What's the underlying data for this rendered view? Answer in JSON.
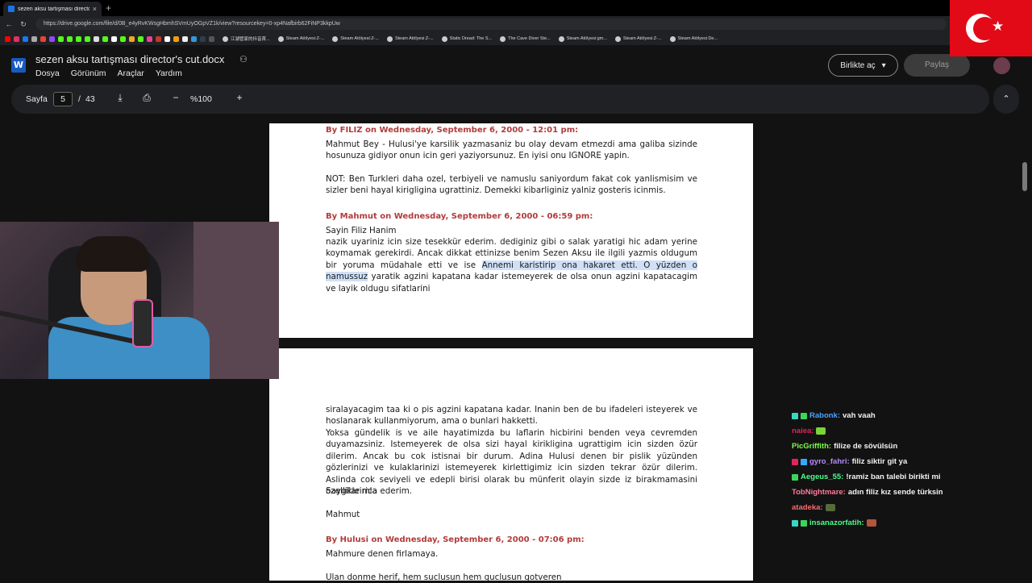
{
  "browser": {
    "tab_title": "sezen aksu tartışması director's cut",
    "url": "https://drive.google.com/file/d/0B_e4yRvKWsgHbmhSVmUyOGpVZ1k/view?resourcekey=0-xp4Nafbirb62FiNP3kkpUw",
    "bookmarks": [
      "江湖管家的抖音首...",
      "Steam AtölyesiːZ-...",
      "Steam AtölyesiːZ-...",
      "Steam AtölyesiːZ-...",
      "Static Dread: The S...",
      "The Cave Diver Ste...",
      "Steam Atölyesiːgm...",
      "Steam AtölyesiːZ-...",
      "Steam AtölyesiːDe..."
    ]
  },
  "drive": {
    "doc_title": "sezen aksu tartışması director's cut.docx",
    "menu": [
      "Dosya",
      "Görünüm",
      "Araçlar",
      "Yardım"
    ],
    "open_with_label": "Birlikte aç",
    "share_label": "Paylaş"
  },
  "viewer": {
    "page_label": "Sayfa",
    "current_page": "5",
    "page_sep": "/",
    "total_pages": "43",
    "zoom": "%100"
  },
  "document": {
    "page1": {
      "h1": "By FILIZ on Wednesday, September 6, 2000 - 12:01 pm:",
      "p1": "Mahmut Bey - Hulusi'ye karsilik yazmasaniz bu olay devam etmezdi ama galiba sizinde hosunuza gidiyor onun icin geri yaziyorsunuz. En iyisi onu IGNORE yapin.",
      "p2": "NOT: Ben Turkleri daha ozel, terbiyeli ve namuslu saniyordum fakat cok yanlismisim ve sizler beni hayal kirigligina ugrattiniz. Demekki kibarliginiz yalniz gosteris icinmis.",
      "h2": "By Mahmut on Wednesday, September 6, 2000 - 06:59 pm:",
      "p3": "Sayin Filiz Hanim",
      "p4_a": "nazik uyariniz icin size tesekkür ederim. dediginiz gibi o salak yaratigi hic adam yerine koymamak gerekirdi. Ancak dikkat ettinizse benim Sezen Aksu ile ilgili yazmis oldugum bir yoruma müdahale etti ve ise ",
      "p4_hl": "Annemi karistirip ona hakaret etti. O yüzden o namussuz",
      "p4_b": " yaratik agzini kapatana kadar istemeyerek de olsa onun agzini kapatacagim ve layik oldugu sifatlarini"
    },
    "page2": {
      "p1": "siralayacagim taa ki o pis agzini kapatana kadar. Inanin ben de bu ifadeleri isteyerek ve hoslanarak kullanmiyorum, ama o bunlari hakketti.",
      "p2": "Yoksa gündelik is ve aile hayatimizda bu laflarin hicbirini benden veya cevremden duyamazsiniz. Istemeyerek de olsa sizi hayal kirikligina ugrattigim icin sizden özür dilerim. Ancak bu cok istisnai bir durum. Adina Hulusi denen bir pislik yüzünden gözlerinizi ve kulaklarinizi istemeyerek kirlettigimiz icin sizden tekrar özür dilerim. Aslinda cok seviyeli ve edepli birisi olarak bu münferit olayin sizde iz birakmamasini özellikle rica ederim.",
      "p3": "Saygilarimla",
      "p4": "Mahmut",
      "h1": "By Hulusi on Wednesday, September 6, 2000 - 07:06 pm:",
      "p5": "Mahmure denen firlamaya.",
      "p6": "Ulan donme herif, hem suclusun hem guclusun gotveren"
    }
  },
  "chat": [
    {
      "user": "Rabonk:",
      "msg": "vah vaah",
      "color": "#4aa3ff",
      "badges": [
        "#3ad6c0",
        "#3ad65a"
      ]
    },
    {
      "user": "naiea:",
      "msg": "",
      "color": "#e0245e",
      "badges": [],
      "emote": "#7bd33a"
    },
    {
      "user": "PicGriffith:",
      "msg": "filize de sövülsün",
      "color": "#7fff4a",
      "badges": []
    },
    {
      "user": "gyro_fahri:",
      "msg": "filiz siktir git ya",
      "color": "#b48cff",
      "badges": [
        "#e0245e",
        "#35a7ff"
      ]
    },
    {
      "user": "Aegeus_55:",
      "msg": "!ramiz ban talebi birikti mi",
      "color": "#4aff8c",
      "badges": [
        "#3ad65a"
      ]
    },
    {
      "user": "TobNightmare:",
      "msg": "adın filiz kız sende türksin",
      "color": "#ff7a9c",
      "badges": []
    },
    {
      "user": "atadeka:",
      "msg": "",
      "color": "#ff6b6b",
      "badges": [],
      "emote": "#556b3a"
    },
    {
      "user": "insanazorfatih:",
      "msg": "",
      "color": "#4aff8c",
      "badges": [
        "#3ad6c0",
        "#3ad65a"
      ],
      "emote": "#b2553a"
    }
  ],
  "colors": {
    "heading_red": "#b23b3b",
    "highlight": "#cfe0f7",
    "flag_red": "#e30a17"
  }
}
